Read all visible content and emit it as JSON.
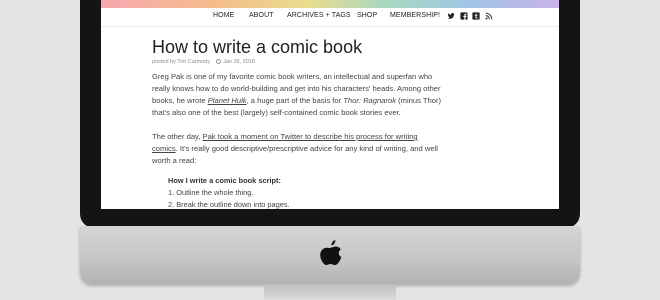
{
  "nav": {
    "items": [
      "HOME",
      "ABOUT",
      "ARCHIVES + TAGS",
      "SHOP",
      "MEMBERSHIP!"
    ],
    "social_icons": [
      "twitter-icon",
      "facebook-icon",
      "tumblr-icon",
      "rss-icon"
    ]
  },
  "post": {
    "title": "How to write a comic book",
    "author": "posted by Tim Carmody",
    "date": "Jan 26, 2018",
    "p1": {
      "line1": "Greg Pak is one of my favorite comic book writers, an intellectual and superfan who",
      "line2": "really knows how to do world-building and get into his characters' heads. Among other",
      "line3_a": "books, he wrote ",
      "line3_link": "Planet Hulk",
      "line3_b": ", a huge part of the basis for ",
      "line3_em": "Thor: Ragnarok",
      "line3_c": " (minus Thor)",
      "line4": "that's also one of the best (largely) self-contained comic book stories ever."
    },
    "p2": {
      "line1_a": "The other day, ",
      "line1_link": "Pak took a moment on Twitter to describe his process for writing",
      "line2_link": "comics",
      "line2_b": ". It's really good descriptive/prescriptive advice for any kind of writing, and well",
      "line3": "worth a read:"
    },
    "script_heading": "How I write a comic book script:",
    "steps": [
      "1. Outline the whole thing.",
      "2. Break the outline down into pages."
    ]
  }
}
